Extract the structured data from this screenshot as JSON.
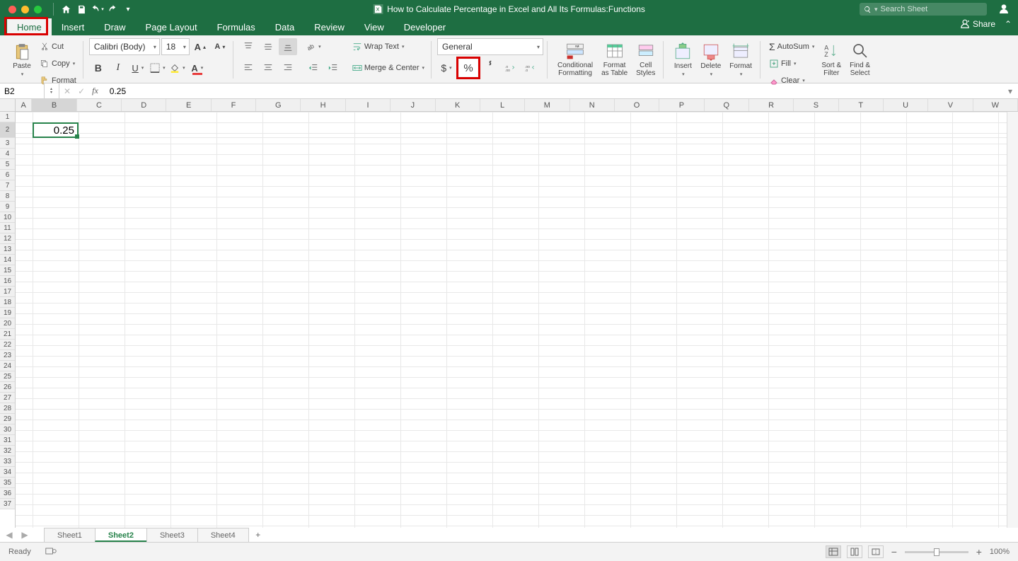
{
  "title": "How to Calculate Percentage in Excel and All Its Formulas:Functions",
  "search_placeholder": "Search Sheet",
  "tabs": [
    "Home",
    "Insert",
    "Draw",
    "Page Layout",
    "Formulas",
    "Data",
    "Review",
    "View",
    "Developer"
  ],
  "active_tab": "Home",
  "share_label": "Share",
  "clipboard": {
    "paste": "Paste",
    "cut": "Cut",
    "copy": "Copy",
    "format": "Format"
  },
  "font": {
    "name": "Calibri (Body)",
    "size": "18"
  },
  "alignment": {
    "wrap": "Wrap Text",
    "merge": "Merge & Center"
  },
  "number_format": "General",
  "styles": {
    "conditional": "Conditional\nFormatting",
    "table": "Format\nas Table",
    "cell": "Cell\nStyles"
  },
  "cells_group": {
    "insert": "Insert",
    "delete": "Delete",
    "format": "Format"
  },
  "editing": {
    "autosum": "AutoSum",
    "fill": "Fill",
    "clear": "Clear",
    "sort": "Sort &\nFilter",
    "find": "Find &\nSelect"
  },
  "formula_bar": {
    "cell_ref": "B2",
    "fx": "fx",
    "value": "0.25"
  },
  "columns": [
    "A",
    "B",
    "C",
    "D",
    "E",
    "F",
    "G",
    "H",
    "I",
    "J",
    "K",
    "L",
    "M",
    "N",
    "O",
    "P",
    "Q",
    "R",
    "S",
    "T",
    "U",
    "V",
    "W"
  ],
  "selected_col": "B",
  "rows": 37,
  "selected_row": 2,
  "active_cell_value": "0.25",
  "sheets": [
    "Sheet1",
    "Sheet2",
    "Sheet3",
    "Sheet4"
  ],
  "active_sheet": "Sheet2",
  "status": "Ready",
  "zoom": "100%"
}
